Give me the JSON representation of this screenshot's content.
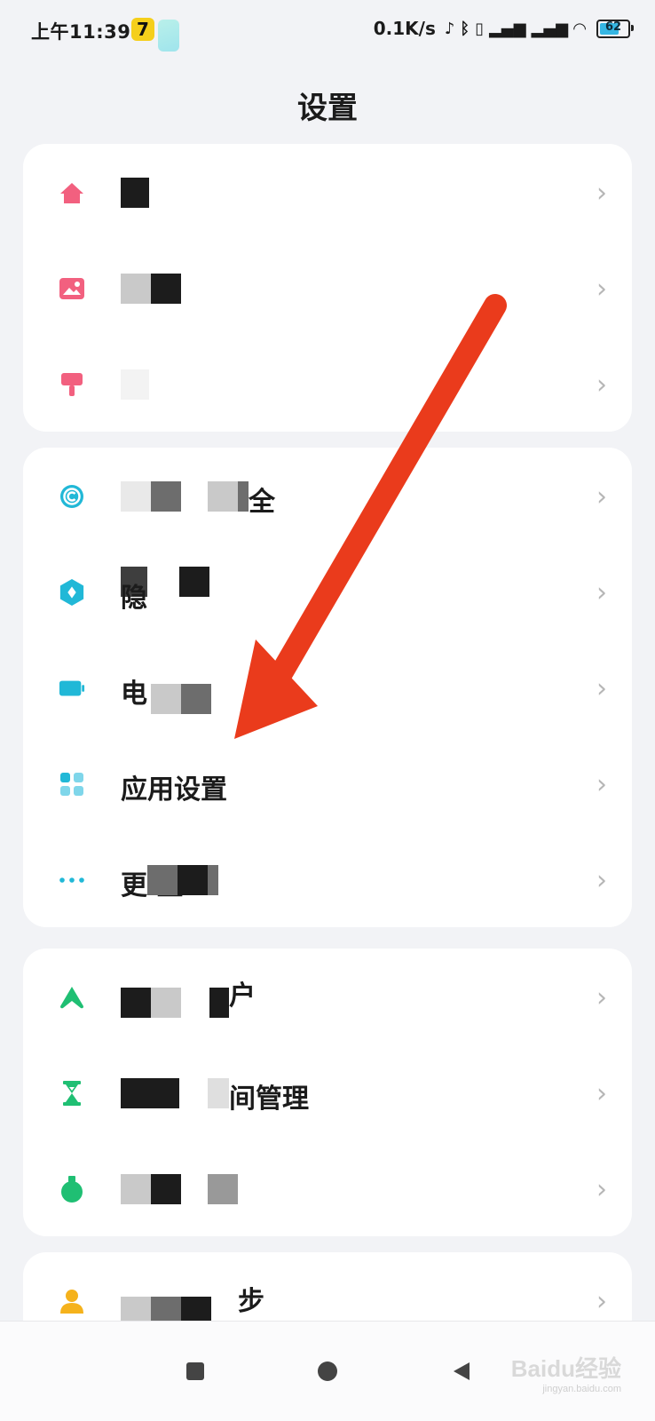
{
  "status_bar": {
    "time": "上午11:39",
    "app_icon_badge": "7",
    "net_speed": "0.1K/s",
    "battery": "62"
  },
  "page": {
    "title": "设置"
  },
  "groups": [
    {
      "items": [
        {
          "label": "",
          "icon": "home-icon",
          "color": "#f2607f"
        },
        {
          "label": "",
          "icon": "image-icon",
          "color": "#f2607f"
        },
        {
          "label": "",
          "icon": "brush-icon",
          "color": "#f2607f"
        }
      ]
    },
    {
      "items": [
        {
          "label": "全",
          "icon": "copyright-icon",
          "color": "#21b8d7"
        },
        {
          "label": "隐",
          "icon": "privacy-hex-icon",
          "color": "#21b8d7"
        },
        {
          "label": "电",
          "icon": "battery-icon",
          "color": "#21b8d7"
        },
        {
          "label": "应用设置",
          "icon": "apps-grid-icon",
          "color": "#21b8d7"
        },
        {
          "label": "更 置",
          "icon": "more-dots-icon",
          "color": "#21b8d7"
        }
      ]
    },
    {
      "items": [
        {
          "label": "户",
          "icon": "a-logo-icon",
          "color": "#1fbf73"
        },
        {
          "label": "间管理",
          "icon": "hourglass-icon",
          "color": "#1fbf73"
        },
        {
          "label": "",
          "icon": "flask-icon",
          "color": "#1fbf73"
        }
      ]
    },
    {
      "items": [
        {
          "label": "步",
          "icon": "user-icon",
          "color": "#f5b21c"
        }
      ]
    }
  ],
  "watermark": {
    "brand": "Baidu经验",
    "url": "jingyan.baidu.com"
  },
  "colors": {
    "arrow": "#ea3b1c",
    "chevron": "#b6b6b6",
    "background": "#f2f3f6"
  }
}
